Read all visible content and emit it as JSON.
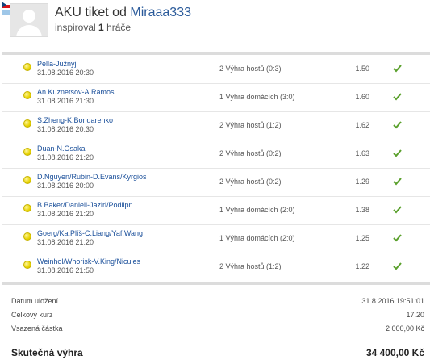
{
  "header": {
    "flags": [
      "czech-flag-icon",
      "small-flag-icon"
    ],
    "title_prefix": "AKU tiket od",
    "username": "Miraaa333",
    "inspired_prefix": "inspiroval",
    "inspired_count": "1",
    "inspired_suffix": "hráče"
  },
  "bets": [
    {
      "match": "Pella-Južnyj",
      "date": "31.08.2016 20:30",
      "pick": "2 Výhra hostů (0:3)",
      "odd": "1.50",
      "status": "check-icon"
    },
    {
      "match": "An.Kuznetsov-A.Ramos",
      "date": "31.08.2016 21:30",
      "pick": "1 Výhra domácích (3:0)",
      "odd": "1.60",
      "status": "check-icon"
    },
    {
      "match": "S.Zheng-K.Bondarenko",
      "date": "31.08.2016 20:30",
      "pick": "2 Výhra hostů (1:2)",
      "odd": "1.62",
      "status": "check-icon"
    },
    {
      "match": "Duan-N.Osaka",
      "date": "31.08.2016 21:20",
      "pick": "2 Výhra hostů (0:2)",
      "odd": "1.63",
      "status": "check-icon"
    },
    {
      "match": "D.Nguyen/Rubin-D.Evans/Kyrgios",
      "date": "31.08.2016 20:00",
      "pick": "2 Výhra hostů (0:2)",
      "odd": "1.29",
      "status": "check-icon"
    },
    {
      "match": "B.Baker/Daniell-Jaziri/Podlipn",
      "date": "31.08.2016 21:20",
      "pick": "1 Výhra domácích (2:0)",
      "odd": "1.38",
      "status": "check-icon"
    },
    {
      "match": "Goerg/Ka.Plíš-C.Liang/Yaf.Wang",
      "date": "31.08.2016 21:20",
      "pick": "1 Výhra domácích (2:0)",
      "odd": "1.25",
      "status": "check-icon"
    },
    {
      "match": "Weinhol/Whorisk-V.King/Nicules",
      "date": "31.08.2016 21:50",
      "pick": "2 Výhra hostů (1:2)",
      "odd": "1.22",
      "status": "check-icon"
    }
  ],
  "summary": {
    "saved_label": "Datum uložení",
    "saved_value": "31.8.2016 19:51:01",
    "total_odds_label": "Celkový kurz",
    "total_odds_value": "17.20",
    "stake_label": "Vsazená částka",
    "stake_value": "2 000,00 Kč",
    "win_label": "Skutečná výhra",
    "win_value": "34 400,00 Kč"
  },
  "colors": {
    "link": "#1a4f9a",
    "check": "#5aa02c",
    "dot": "#e8d300"
  }
}
